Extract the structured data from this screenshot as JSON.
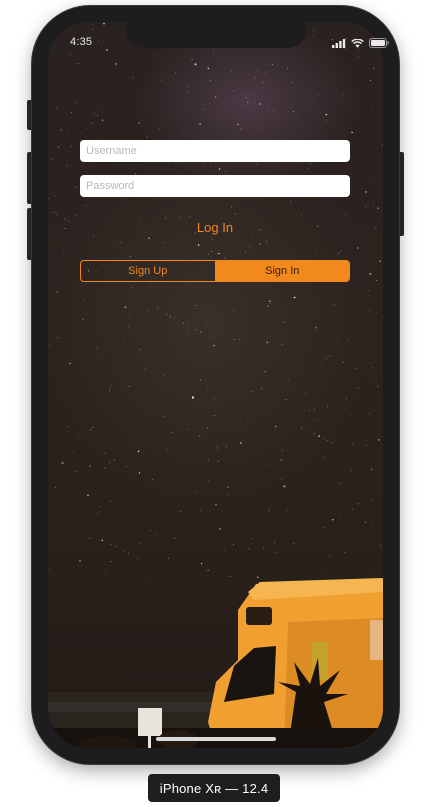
{
  "status_bar": {
    "time": "4:35"
  },
  "form": {
    "username_placeholder": "Username",
    "password_placeholder": "Password",
    "login_label": "Log In"
  },
  "segmented_control": {
    "options": [
      "Sign Up",
      "Sign In"
    ],
    "selected": "Sign In"
  },
  "device_label": "iPhone Xʀ — 12.4",
  "colors": {
    "accent": "#f2891d",
    "phone_body": "#1d1d1f"
  },
  "icons": [
    "signal-icon",
    "wifi-icon",
    "battery-icon"
  ]
}
